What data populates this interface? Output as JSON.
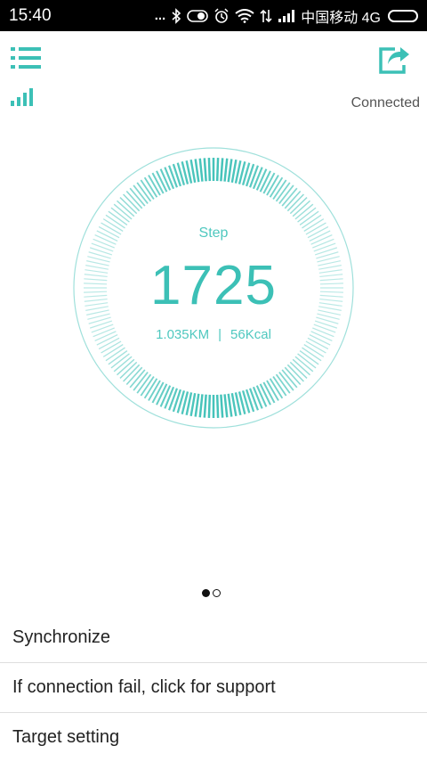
{
  "status_bar": {
    "time": "15:40",
    "dots": "...",
    "carrier": "中国移动 4G"
  },
  "header": {
    "connection_status": "Connected"
  },
  "step_card": {
    "label": "Step",
    "value": "1725",
    "distance": "1.035KM",
    "separator": "|",
    "calories": "56Kcal",
    "accent_color": "#3cc0b6",
    "goal_progress_note": "arc gauge, denser ticks near top and bottom"
  },
  "pager": {
    "pages": 2,
    "active_index": 0
  },
  "menu": {
    "items": [
      {
        "label": "Synchronize"
      },
      {
        "label": "If connection fail, click for support"
      },
      {
        "label": "Target setting"
      }
    ]
  },
  "icons": {
    "menu": "list-menu-icon",
    "share": "share-export-icon",
    "signal": "signal-strength-icon"
  }
}
